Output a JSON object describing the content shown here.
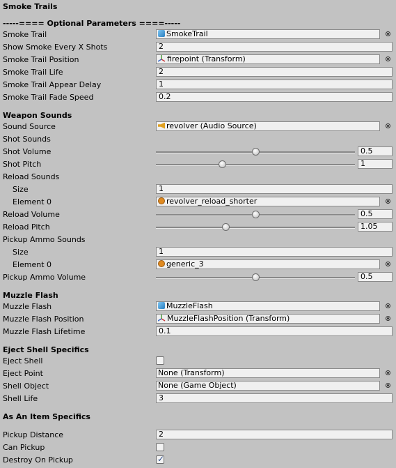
{
  "smoke": {
    "title": "Smoke Trails",
    "optional_header": "-----==== Optional Parameters ====-----",
    "smoke_trail": {
      "label": "Smoke Trail",
      "value": "SmokeTrail"
    },
    "show_every": {
      "label": "Show Smoke Every X Shots",
      "value": "2"
    },
    "position": {
      "label": "Smoke Trail Position",
      "value": "firepoint (Transform)"
    },
    "life": {
      "label": "Smoke Trail Life",
      "value": "2"
    },
    "appear_delay": {
      "label": "Smoke Trail Appear Delay",
      "value": "1"
    },
    "fade_speed": {
      "label": "Smoke Trail Fade Speed",
      "value": "0.2"
    }
  },
  "sounds": {
    "title": "Weapon Sounds",
    "source": {
      "label": "Sound Source",
      "value": "revolver (Audio Source)"
    },
    "shot_sounds": "Shot Sounds",
    "shot_volume": {
      "label": "Shot Volume",
      "value": "0.5",
      "level": 0.5
    },
    "shot_pitch": {
      "label": "Shot Pitch",
      "value": "1",
      "level": 0.333
    },
    "reload_sounds": "Reload Sounds",
    "reload_size": {
      "label": "Size",
      "value": "1"
    },
    "reload_element": {
      "label": "Element 0",
      "value": "revolver_reload_shorter"
    },
    "reload_volume": {
      "label": "Reload Volume",
      "value": "0.5",
      "level": 0.5
    },
    "reload_pitch": {
      "label": "Reload Pitch",
      "value": "1.05",
      "level": 0.35
    },
    "pickup_sounds": "Pickup Ammo Sounds",
    "pickup_size": {
      "label": "Size",
      "value": "1"
    },
    "pickup_element": {
      "label": "Element 0",
      "value": "generic_3"
    },
    "pickup_volume": {
      "label": "Pickup Ammo Volume",
      "value": "0.5",
      "level": 0.5
    }
  },
  "muzzle": {
    "title": "Muzzle Flash",
    "flash": {
      "label": "Muzzle Flash",
      "value": "MuzzleFlash"
    },
    "position": {
      "label": "Muzzle Flash Position",
      "value": "MuzzleFlashPosition (Transform)"
    },
    "lifetime": {
      "label": "Muzzle Flash Lifetime",
      "value": "0.1"
    }
  },
  "eject": {
    "title": "Eject Shell Specifics",
    "eject_shell": {
      "label": "Eject Shell",
      "checked": false
    },
    "eject_point": {
      "label": "Eject Point",
      "value": "None (Transform)"
    },
    "shell_object": {
      "label": "Shell Object",
      "value": "None (Game Object)"
    },
    "shell_life": {
      "label": "Shell Life",
      "value": "3"
    }
  },
  "item": {
    "title": "As An Item Specifics",
    "pickup_distance": {
      "label": "Pickup Distance",
      "value": "2"
    },
    "can_pickup": {
      "label": "Can Pickup",
      "checked": false
    },
    "destroy_on_pickup": {
      "label": "Destroy On Pickup",
      "checked": true
    }
  },
  "icons": {
    "prefab": "prefab-cube-icon",
    "transform": "transform-axes-icon",
    "audio_source": "audio-source-icon",
    "audio_clip": "audio-clip-icon",
    "object_picker": "object-picker-icon"
  },
  "colors": {
    "background": "#c2c2c2",
    "field": "#f0f0f0",
    "check": "#2a4a8a"
  }
}
